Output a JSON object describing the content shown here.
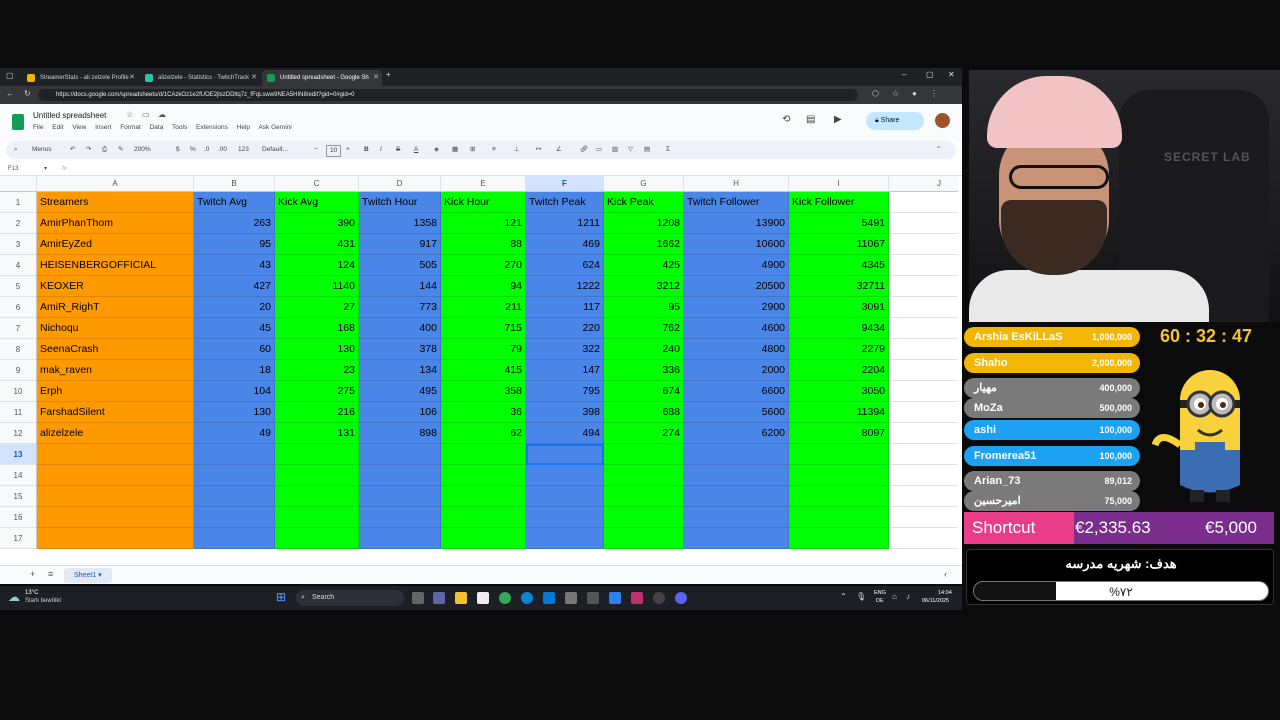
{
  "browser": {
    "tabs": [
      {
        "label": "StreamerStats - ali zelzele Profile",
        "color": "#f4b400"
      },
      {
        "label": "alizelzele - Statistics · TwitchTrack",
        "color": "#29c4a9"
      },
      {
        "label": "Untitled spreadsheet - Google Sh",
        "color": "#0f9d58"
      }
    ],
    "new_tab": "+",
    "url": "https://docs.google.com/spreadsheets/d/1CAzkOz1e2fUOE2jlszDDltq7z_fFqLsww9NEA5HIN8/edit?gid=0#gid=0"
  },
  "sheets": {
    "title": "Untitled spreadsheet",
    "menu": [
      "File",
      "Edit",
      "View",
      "Insert",
      "Format",
      "Data",
      "Tools",
      "Extensions",
      "Help",
      "Ask Gemini"
    ],
    "share_label": "Share",
    "toolbar": {
      "menus": "Menus",
      "zoom": "200%",
      "currency": "$",
      "percent": "%",
      "dec1": ".0",
      "dec2": ".00",
      "format123": "123",
      "font": "Default...",
      "font_size": "10",
      "bold": "B",
      "italic": "I",
      "strike": "S",
      "textcolor": "A",
      "sigma": "Σ"
    },
    "name_box": "F13",
    "fx": "fx",
    "sheet_tab": "Sheet1",
    "selected_col": "F",
    "selected_row": "13",
    "columns": [
      "A",
      "B",
      "C",
      "D",
      "E",
      "F",
      "G",
      "H",
      "I",
      "J"
    ],
    "header": [
      "Streamers",
      "Twitch Avg",
      "Kick Avg",
      "Twitch Hour",
      "Kick Hour",
      "Twitch Peak",
      "Kick Peak",
      "Twitch Follower",
      "Kick Follower"
    ],
    "rows": [
      [
        "AmirPhanThom",
        "263",
        "390",
        "1358",
        "121",
        "1211",
        "1208",
        "13900",
        "5491"
      ],
      [
        "AmirEyZed",
        "95",
        "431",
        "917",
        "88",
        "469",
        "1662",
        "10600",
        "11067"
      ],
      [
        "HEISENBERGOFFICIAL",
        "43",
        "124",
        "505",
        "270",
        "624",
        "425",
        "4900",
        "4345"
      ],
      [
        "KEOXER",
        "427",
        "1140",
        "144",
        "94",
        "1222",
        "3212",
        "20500",
        "32711"
      ],
      [
        "AmiR_RighT",
        "20",
        "27",
        "773",
        "211",
        "117",
        "95",
        "2900",
        "3091"
      ],
      [
        "Nichoqu",
        "45",
        "168",
        "400",
        "715",
        "220",
        "762",
        "4600",
        "9434"
      ],
      [
        "SeenaCrash",
        "60",
        "130",
        "378",
        "79",
        "322",
        "240",
        "4800",
        "2279"
      ],
      [
        "mak_raven",
        "18",
        "23",
        "134",
        "415",
        "147",
        "336",
        "2000",
        "2204"
      ],
      [
        "Erph",
        "104",
        "275",
        "495",
        "358",
        "795",
        "674",
        "6600",
        "3050"
      ],
      [
        "FarshadSilent",
        "130",
        "216",
        "106",
        "36",
        "398",
        "688",
        "5600",
        "11394"
      ],
      [
        "alizelzele",
        "49",
        "131",
        "898",
        "62",
        "494",
        "274",
        "6200",
        "8097"
      ]
    ],
    "row_numbers": [
      "1",
      "2",
      "3",
      "4",
      "5",
      "6",
      "7",
      "8",
      "9",
      "10",
      "11",
      "12",
      "13",
      "14",
      "15",
      "16",
      "17"
    ],
    "colors": {
      "orange": "#ff9900",
      "blue": "#4a86e8",
      "green": "#00ff00"
    }
  },
  "taskbar": {
    "weather_temp": "13°C",
    "weather_desc": "Stark bewölkt",
    "search": "Search",
    "lang1": "ENG",
    "lang2": "DE",
    "time": "14:04",
    "date": "06/11/2025"
  },
  "stream": {
    "donors": [
      {
        "name": "Arshia EsKiLLaS",
        "amount": "1,000,000",
        "color": "#f2b705"
      },
      {
        "name": "Shaho",
        "amount": "2,000,000",
        "color": "#f2b705"
      },
      {
        "name": "مهيار",
        "amount": "400,000",
        "color": "#7a7a7a"
      },
      {
        "name": "MoZa",
        "amount": "500,000",
        "color": "#7a7a7a"
      },
      {
        "name": "ashi",
        "amount": "100,000",
        "color": "#1da1f2"
      },
      {
        "name": "Fromerea51",
        "amount": "100,000",
        "color": "#1da1f2"
      },
      {
        "name": "Arian_73",
        "amount": "89,012",
        "color": "#7a7a7a"
      },
      {
        "name": "اميرحسين",
        "amount": "75,000",
        "color": "#7a7a7a"
      }
    ],
    "timer": "60 : 32 : 47",
    "shortcut_label": "Shortcut",
    "shortcut_current": "€2,335.63",
    "shortcut_goal": "€5,000",
    "goal_title": "هدف: شهريه مدرسه",
    "goal_percent_text": "%۷۲",
    "goal_fraction": 0.72,
    "cam_brand": "SECRET LAB"
  }
}
